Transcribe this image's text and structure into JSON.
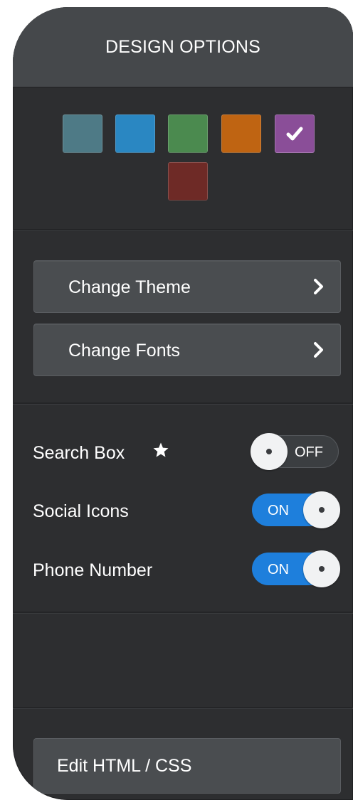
{
  "header": {
    "title": "DESIGN OPTIONS"
  },
  "colors": {
    "panel_bg": "#2d2e30",
    "header_bg": "#45484b",
    "toggle_on": "#1e7fdc"
  },
  "swatches": [
    {
      "name": "slate-teal",
      "color": "#4e7a86",
      "selected": false
    },
    {
      "name": "blue",
      "color": "#2a87c2",
      "selected": false
    },
    {
      "name": "green",
      "color": "#4b8a4f",
      "selected": false
    },
    {
      "name": "orange",
      "color": "#bf6412",
      "selected": false
    },
    {
      "name": "purple",
      "color": "#8a4e98",
      "selected": true,
      "icon": "check-icon"
    },
    {
      "name": "dark-red",
      "color": "#6e2a26",
      "selected": false
    }
  ],
  "buttons": {
    "change_theme": {
      "label": "Change Theme",
      "icon": "chevron-right-icon"
    },
    "change_fonts": {
      "label": "Change Fonts",
      "icon": "chevron-right-icon"
    }
  },
  "toggles": [
    {
      "label": "Search Box",
      "state": "OFF",
      "icon": "star-icon"
    },
    {
      "label": "Social Icons",
      "state": "ON"
    },
    {
      "label": "Phone Number",
      "state": "ON"
    }
  ],
  "footer": {
    "edit_label": "Edit HTML / CSS"
  }
}
